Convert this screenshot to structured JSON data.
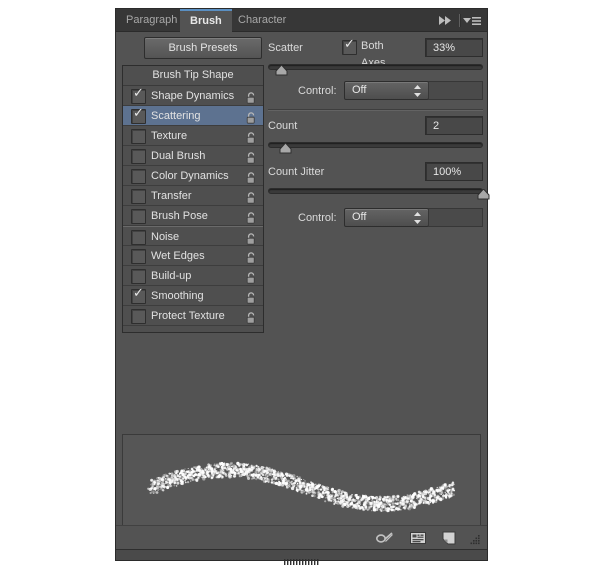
{
  "app": {
    "panel_title": "Brush"
  },
  "tabs": [
    {
      "label": "Paragraph",
      "active": false
    },
    {
      "label": "Brush",
      "active": true
    },
    {
      "label": "Character",
      "active": false
    }
  ],
  "header": {
    "collapse_icon": "double-chevron-right-icon",
    "menu_icon": "panel-menu-icon"
  },
  "toolbar": {
    "presets_label": "Brush Presets"
  },
  "option_list": {
    "header": "Brush Tip Shape",
    "items": [
      {
        "label": "Shape Dynamics",
        "checked": true,
        "selected": false,
        "locked": true,
        "group_start": false
      },
      {
        "label": "Scattering",
        "checked": true,
        "selected": true,
        "locked": true,
        "group_start": false
      },
      {
        "label": "Texture",
        "checked": false,
        "selected": false,
        "locked": true,
        "group_start": false
      },
      {
        "label": "Dual Brush",
        "checked": false,
        "selected": false,
        "locked": true,
        "group_start": false
      },
      {
        "label": "Color Dynamics",
        "checked": false,
        "selected": false,
        "locked": true,
        "group_start": false
      },
      {
        "label": "Transfer",
        "checked": false,
        "selected": false,
        "locked": true,
        "group_start": false
      },
      {
        "label": "Brush Pose",
        "checked": false,
        "selected": false,
        "locked": true,
        "group_start": false
      },
      {
        "label": "Noise",
        "checked": false,
        "selected": false,
        "locked": true,
        "group_start": true
      },
      {
        "label": "Wet Edges",
        "checked": false,
        "selected": false,
        "locked": true,
        "group_start": false
      },
      {
        "label": "Build-up",
        "checked": false,
        "selected": false,
        "locked": true,
        "group_start": false
      },
      {
        "label": "Smoothing",
        "checked": true,
        "selected": false,
        "locked": true,
        "group_start": false
      },
      {
        "label": "Protect Texture",
        "checked": false,
        "selected": false,
        "locked": true,
        "group_start": false
      }
    ]
  },
  "scattering": {
    "scatter": {
      "label": "Scatter",
      "both_axes_label": "Both Axes",
      "both_axes_checked": true,
      "value": "33%",
      "slider_percent": 6,
      "control_label": "Control:",
      "control_value": "Off"
    },
    "count": {
      "label": "Count",
      "value": "2",
      "slider_percent": 8
    },
    "count_jitter": {
      "label": "Count Jitter",
      "value": "100%",
      "slider_percent": 100,
      "control_label": "Control:",
      "control_value": "Off"
    }
  },
  "preview": {
    "name": "brush-stroke-preview"
  },
  "bottom_toolbar": {
    "icons": [
      {
        "name": "toggle-dirty-brush-icon"
      },
      {
        "name": "new-brush-preset-icon"
      },
      {
        "name": "create-new-brush-icon"
      }
    ],
    "resize_grip": "resize-grip-icon"
  },
  "colors": {
    "panel_bg": "#535353",
    "tabstrip_bg": "#373737",
    "list_bg": "#4f4f4f",
    "selection": "#5d7290",
    "accent_tab_underline": "#5a8fc2",
    "text": "#e2e2e2",
    "value_field_bg": "#484848"
  }
}
